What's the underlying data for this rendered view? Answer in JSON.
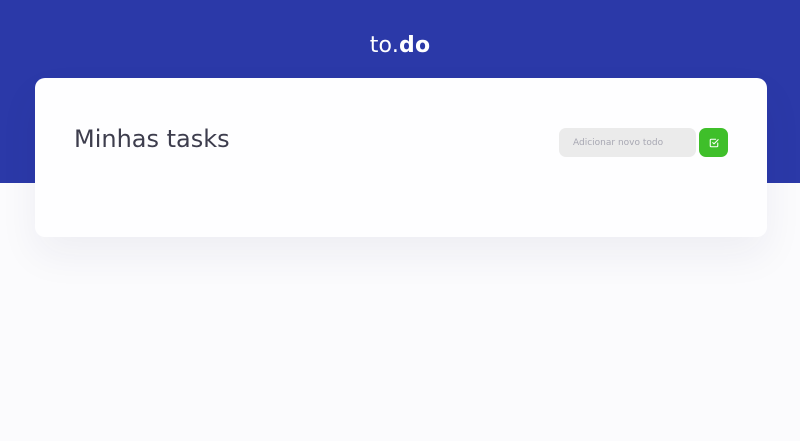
{
  "header": {
    "logo_prefix": "to.",
    "logo_suffix": "do",
    "background_color": "#2b39a8"
  },
  "tasks": {
    "title": "Minhas tasks",
    "new_todo": {
      "value": "",
      "placeholder": "Adicionar novo todo"
    },
    "add_button": {
      "icon": "check-square-icon",
      "color": "#3fbf2a"
    }
  }
}
